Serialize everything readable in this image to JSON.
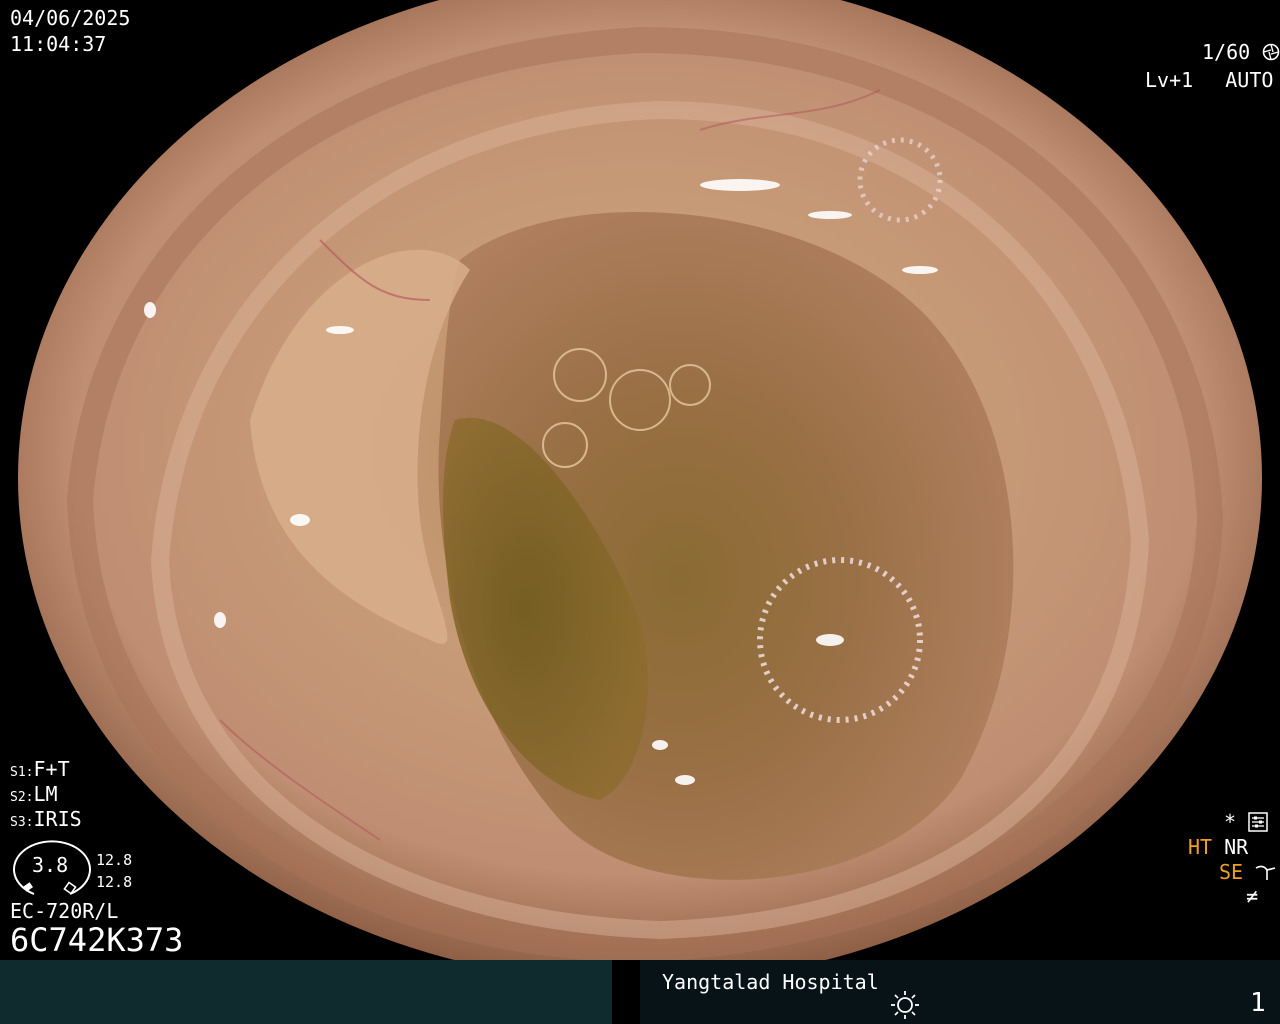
{
  "top_left": {
    "date": "04/06/2025",
    "time": "11:04:37"
  },
  "top_right": {
    "shutter": "1/60",
    "level": "Lv+1",
    "mode": "AUTO"
  },
  "left_panel": {
    "s1_key": "S1:",
    "s1_val": "F+T",
    "s2_key": "S2:",
    "s2_val": "LM",
    "s3_key": "S3:",
    "s3_val": "IRIS",
    "gauge_value": "3.8",
    "reading_a": "12.8",
    "reading_b": "12.8",
    "scope_model": "EC-720R/L",
    "serial": "6C742K373"
  },
  "right_panel": {
    "star": "*",
    "ht": "HT",
    "nr": "NR",
    "se": "SE",
    "ne": "≠"
  },
  "footer": {
    "hospital": "Yangtalad Hospital",
    "page": "1"
  },
  "colors": {
    "orange": "#f0a020",
    "footer_left": "#0f2b2e",
    "footer_right": "#071317"
  }
}
